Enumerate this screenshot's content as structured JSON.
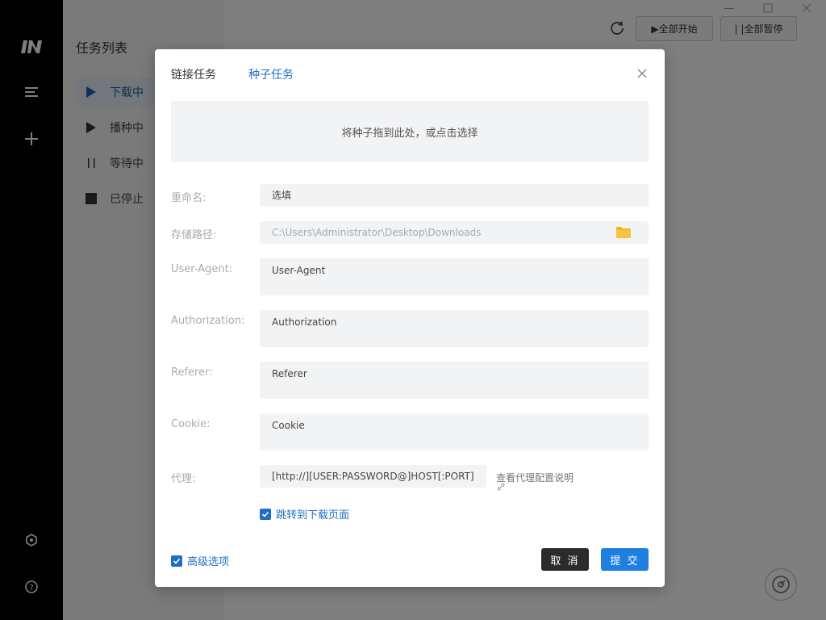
{
  "colors": {
    "accent": "#1f7fe0",
    "rail_bg": "#000000",
    "overlay": "rgba(0,0,0,0.5)"
  },
  "window": {
    "minimize_icon": "minimize-icon",
    "maximize_icon": "maximize-icon",
    "close_icon": "close-icon"
  },
  "rail": {
    "logo_icon": "motrix-logo-icon",
    "items": [
      "menu-icon",
      "plus-icon"
    ],
    "bottom_items": [
      "settings-hexagon-icon",
      "help-icon"
    ]
  },
  "tasks": {
    "title": "任务列表",
    "items": [
      {
        "label": "下载中",
        "icon": "play-icon",
        "active": true
      },
      {
        "label": "播种中",
        "icon": "play-icon",
        "active": false
      },
      {
        "label": "等待中",
        "icon": "pause-icon",
        "active": false
      },
      {
        "label": "已停止",
        "icon": "stop-icon",
        "active": false
      }
    ]
  },
  "toolbar": {
    "refresh_icon": "refresh-icon",
    "start_all": "▶全部开始",
    "pause_all": "| |全部暂停"
  },
  "dialog": {
    "tabs": {
      "link": "链接任务",
      "torrent": "种子任务"
    },
    "dropzone": "将种子拖到此处，或点击选择",
    "rename": {
      "label": "重命名:",
      "value": "选填"
    },
    "save_path": {
      "label": "存储路径:",
      "placeholder": "C:\\Users\\Administrator\\Desktop\\Downloads"
    },
    "user_agent": {
      "label": "User-Agent:",
      "placeholder": "User-Agent"
    },
    "authorization": {
      "label": "Authorization:",
      "placeholder": "Authorization"
    },
    "referer": {
      "label": "Referer:",
      "placeholder": "Referer"
    },
    "cookie": {
      "label": "Cookie:",
      "placeholder": "Cookie"
    },
    "proxy": {
      "label": "代理:",
      "placeholder": "[http://][USER:PASSWORD@]HOST[:PORT]",
      "help": "查看代理配置说明"
    },
    "jump_checkbox": {
      "label": "跳转到下载页面",
      "checked": true
    },
    "advanced_checkbox": {
      "label": "高级选项",
      "checked": true
    },
    "cancel": "取 消",
    "submit": "提 交"
  }
}
